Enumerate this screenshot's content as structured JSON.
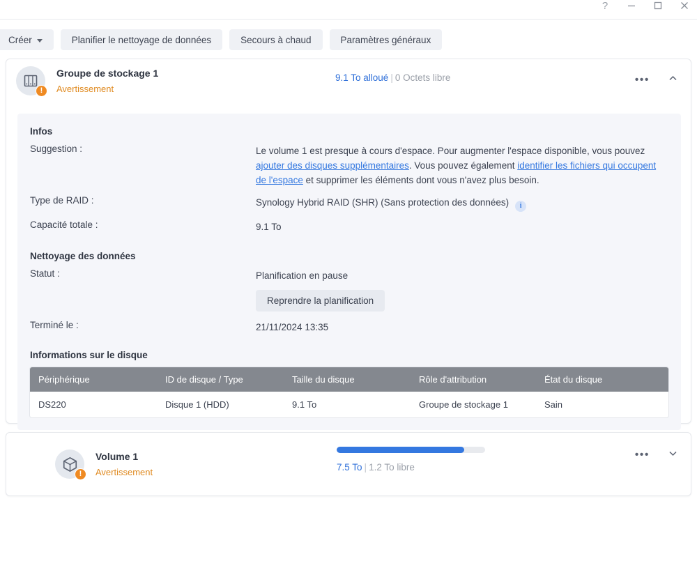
{
  "window": {
    "controls": [
      {
        "name": "help",
        "glyph": "?"
      },
      {
        "name": "minimize",
        "glyph": "–"
      },
      {
        "name": "maximize",
        "glyph": "□"
      },
      {
        "name": "close",
        "glyph": "×"
      }
    ]
  },
  "toolbar": {
    "create_label": "Créer",
    "schedule_label": "Planifier le nettoyage de données",
    "hotspare_label": "Secours à chaud",
    "settings_label": "Paramètres généraux"
  },
  "storage_group": {
    "icon": "storage-pool-icon",
    "title": "Groupe de stockage 1",
    "status": "Avertissement",
    "status_badge": "!",
    "allocated": "9.1 To alloué",
    "separator": "|",
    "free": "0 Octets libre",
    "more_glyph": "•••",
    "collapse_state": "expanded",
    "infos": {
      "heading": "Infos",
      "suggestion_label": "Suggestion :",
      "suggestion_part1": "Le volume 1 est presque à cours d'espace. Pour augmenter l'espace disponible, vous pouvez ",
      "suggestion_link1": "ajouter des disques supplémentaires",
      "suggestion_part2": ". Vous pouvez également ",
      "suggestion_link2": "identifier les fichiers qui occupent de l'espace",
      "suggestion_part3": " et supprimer les éléments dont vous n'avez plus besoin.",
      "raid_label": "Type de RAID :",
      "raid_value": "Synology Hybrid RAID (SHR) (Sans protection des données)",
      "raid_info_glyph": "i",
      "capacity_label": "Capacité totale :",
      "capacity_value": "9.1 To"
    },
    "scrubbing": {
      "heading": "Nettoyage des données",
      "status_label": "Statut :",
      "status_value": "Planification en pause",
      "resume_button": "Reprendre la planification",
      "finished_label": "Terminé le :",
      "finished_value": "21/11/2024 13:35"
    },
    "disk_info": {
      "heading": "Informations sur le disque",
      "columns": [
        "Périphérique",
        "ID de disque / Type",
        "Taille du disque",
        "Rôle d'attribution",
        "État du disque"
      ],
      "rows": [
        {
          "device": "DS220",
          "disk_id": "Disque 1 (HDD)",
          "size": "9.1 To",
          "role": "Groupe de stockage 1",
          "health": "Sain"
        }
      ]
    }
  },
  "volume": {
    "icon": "volume-cube-icon",
    "title": "Volume 1",
    "status": "Avertissement",
    "status_badge": "!",
    "used": "7.5 To",
    "separator": "|",
    "free": "1.2 To libre",
    "usage_percent": 86,
    "more_glyph": "•••",
    "collapse_state": "collapsed"
  },
  "colors": {
    "accent_blue": "#3478e0",
    "link_blue": "#2e6fd9",
    "warning_orange": "#e08b22",
    "healthy_green": "#2fa845",
    "panel_bg": "#f5f6fa",
    "table_header": "#84888f"
  }
}
